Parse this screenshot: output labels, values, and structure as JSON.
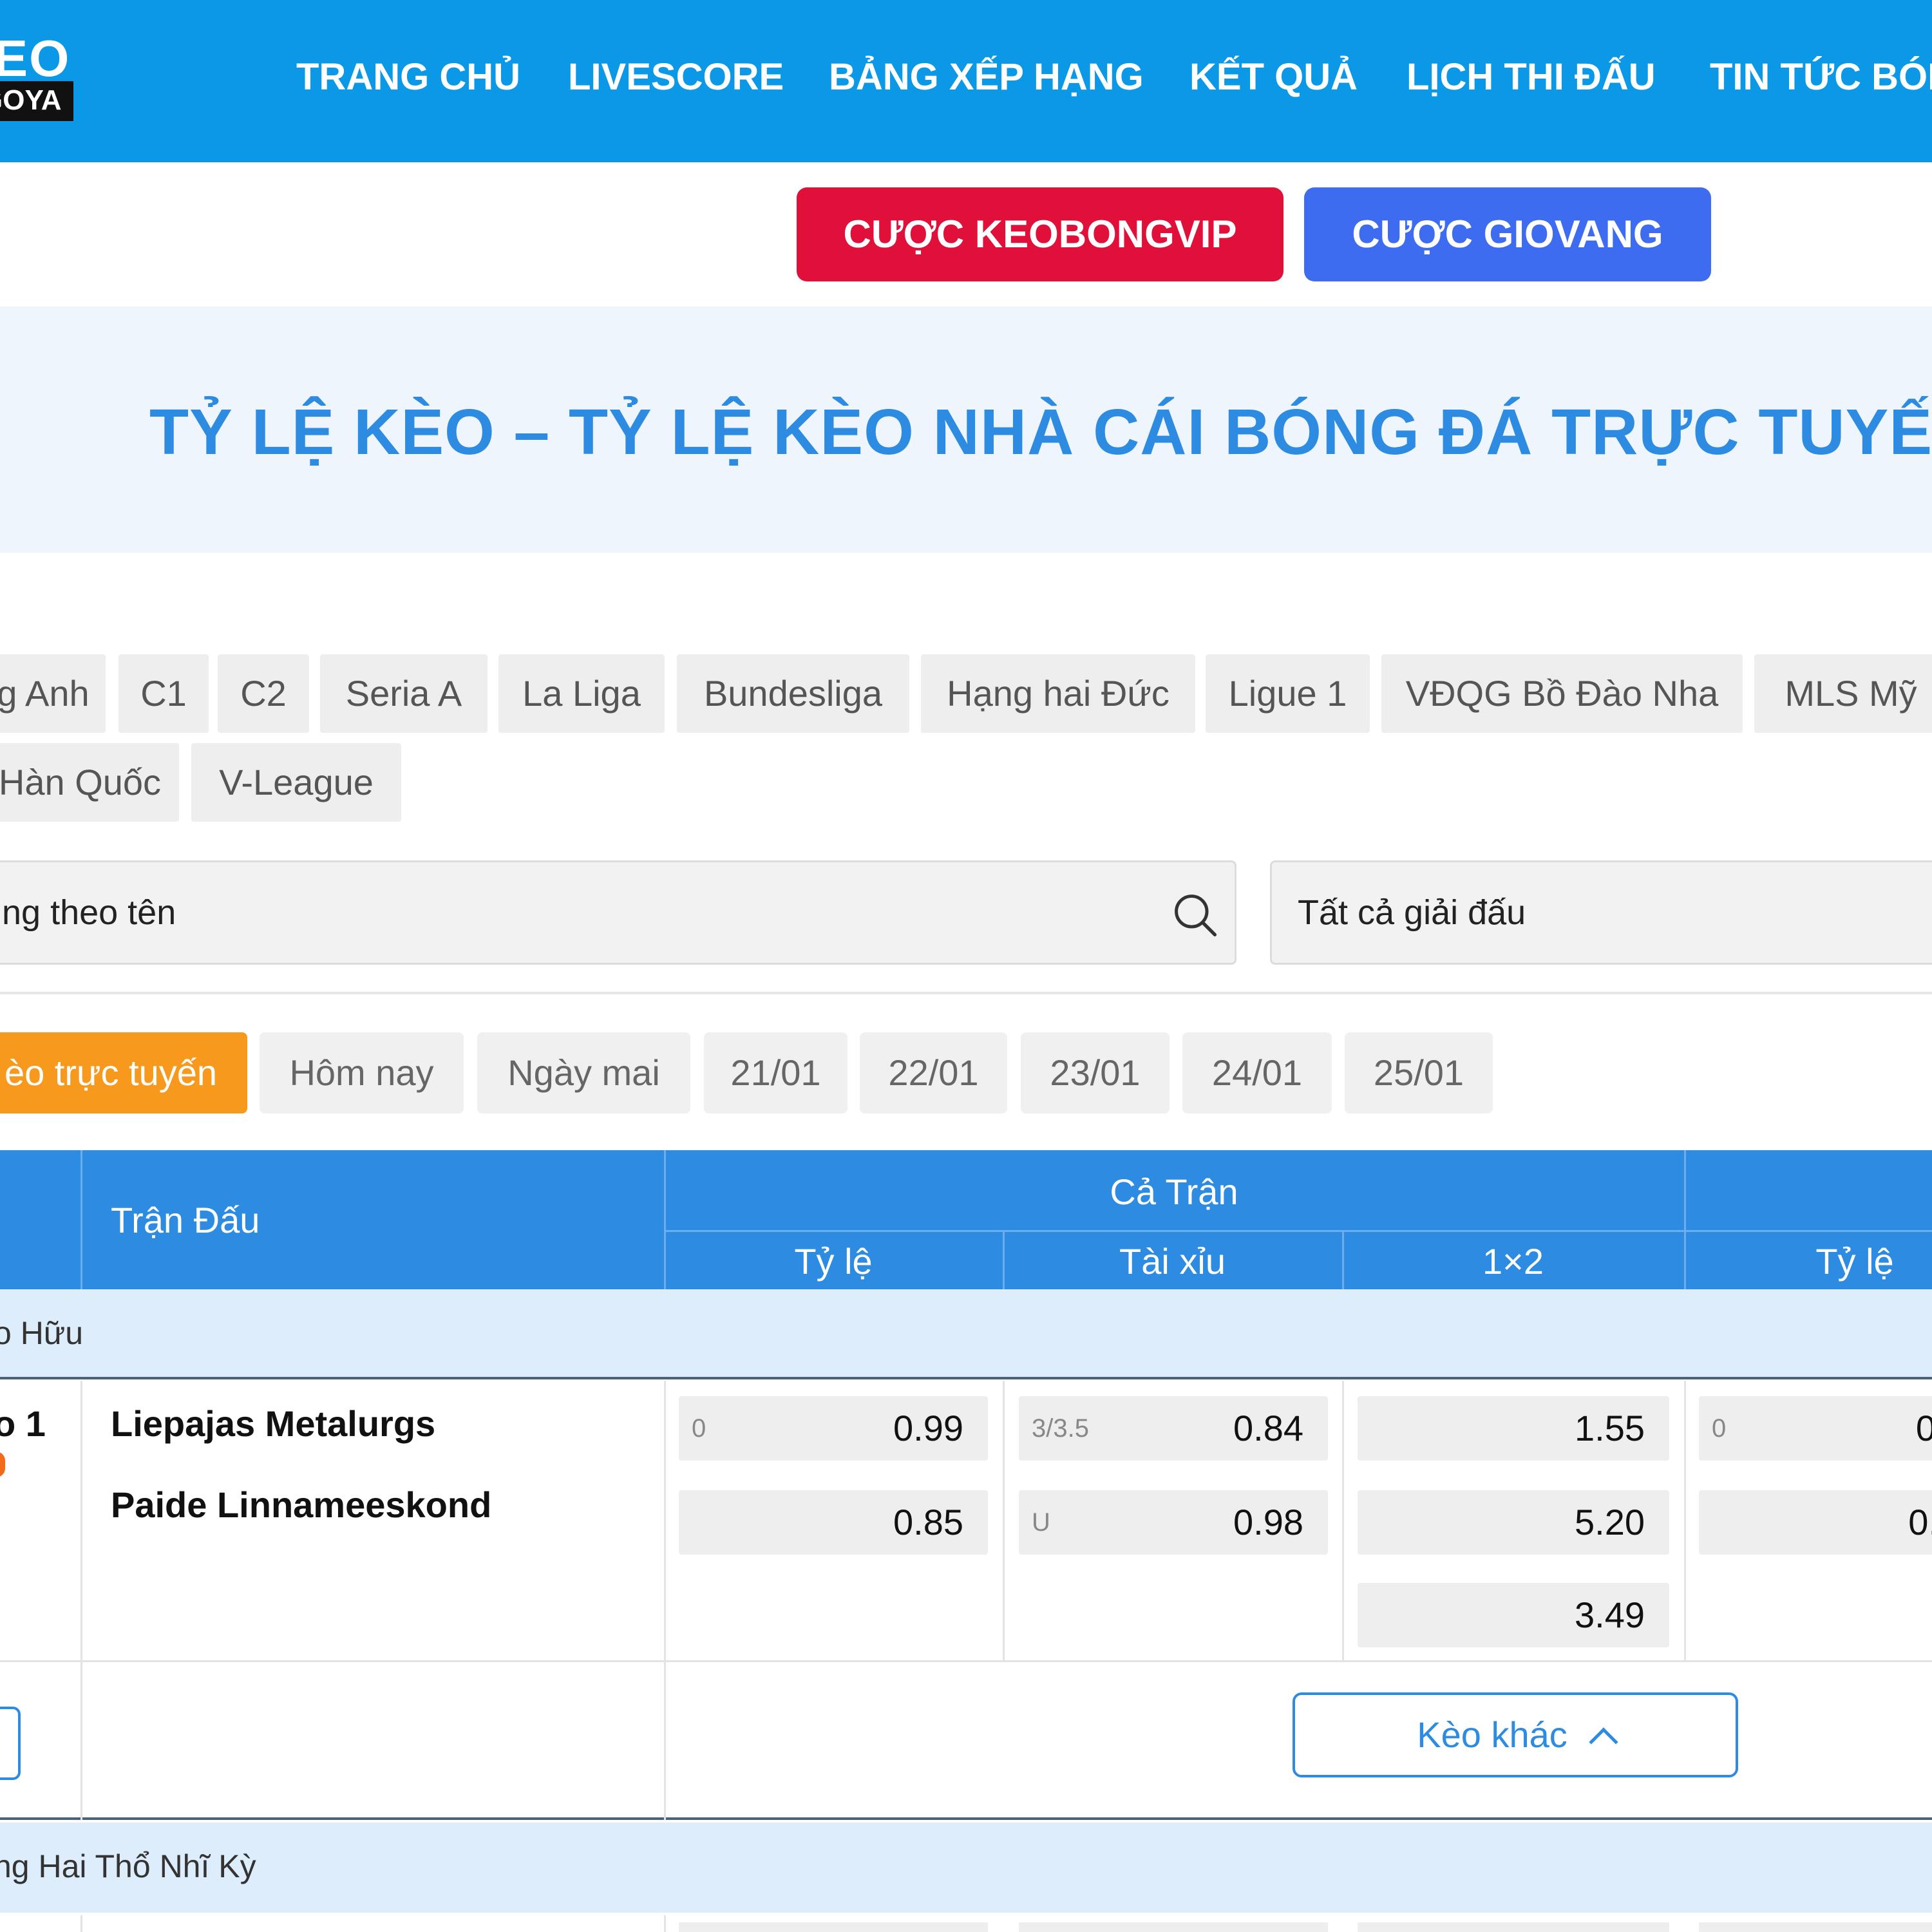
{
  "logo": {
    "top": "KEO",
    "bottom": "GOYA"
  },
  "nav": [
    "TRANG CHỦ",
    "LIVESCORE",
    "BẢNG XẾP HẠNG",
    "KẾT QUẢ",
    "LỊCH THI ĐẤU",
    "TIN TỨC BÓN"
  ],
  "promo": {
    "red": "CƯỢC KEOBONGVIP",
    "blue": "CƯỢC GIOVANG"
  },
  "banner_title": "TỶ LỆ KÈO – TỶ LỆ KÈO NHÀ CÁI BÓNG ĐÁ TRỰC TUYẾ",
  "league_chips_row1": [
    "g Anh",
    "C1",
    "C2",
    "Seria A",
    "La Liga",
    "Bundesliga",
    "Hạng hai Đức",
    "Ligue 1",
    "VĐQG Bồ Đào Nha",
    "MLS Mỹ"
  ],
  "league_chips_row2": [
    "Hàn Quốc",
    "V-League"
  ],
  "search": {
    "placeholder": "ng theo tên"
  },
  "league_select": "Tất cả giải đấu",
  "date_tabs": [
    "èo trực tuyến",
    "Hôm nay",
    "Ngày mai",
    "21/01",
    "22/01",
    "23/01",
    "24/01",
    "25/01"
  ],
  "table": {
    "match_header": "Trận Đấu",
    "full_match": "Cả Trận",
    "sub_headers": [
      "Tỷ lệ",
      "Tài xỉu",
      "1×2",
      "Tỷ lệ"
    ]
  },
  "leagues": [
    {
      "name": "o Hữu",
      "match": {
        "number": "o 1",
        "home": "Liepajas Metalurgs",
        "away": "Paide Linnameeskond",
        "handicap": {
          "line": "0",
          "home": "0.99",
          "away": "0.85"
        },
        "overunder": {
          "line": "3/3.5",
          "over": "0.84",
          "under_label": "U",
          "under": "0.98"
        },
        "x12": {
          "home": "1.55",
          "away": "5.20",
          "draw": "3.49"
        },
        "half_handicap": {
          "line": "0",
          "home": "0",
          "away": "0."
        }
      },
      "more_odds": "Kèo khác"
    },
    {
      "name": "ng Hai Thổ Nhĩ Kỳ"
    }
  ]
}
